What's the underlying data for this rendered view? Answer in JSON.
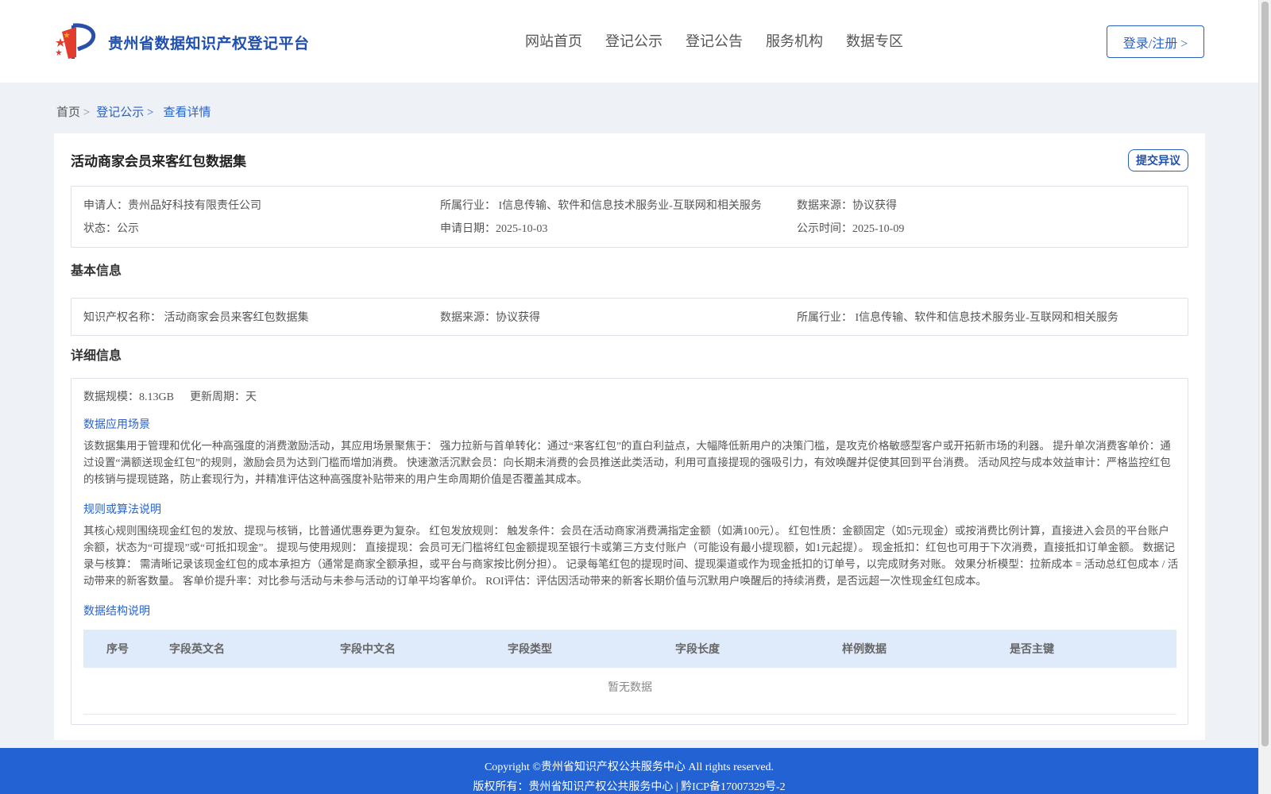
{
  "header": {
    "site_title": "贵州省数据知识产权登记平台",
    "nav": [
      "网站首页",
      "登记公示",
      "登记公告",
      "服务机构",
      "数据专区"
    ],
    "login_label": "登录/注册 >"
  },
  "breadcrumb": {
    "home": "首页",
    "sep": ">",
    "level1": "登记公示",
    "current": "查看详情"
  },
  "record": {
    "title": "活动商家会员来客红包数据集",
    "objection_label": "提交异议",
    "summary": {
      "applicant": "申请人：贵州品好科技有限责任公司",
      "industry": "所属行业： I信息传输、软件和信息技术服务业-互联网和相关服务",
      "source": "数据来源：协议获得",
      "status": "状态：公示",
      "apply_date": "申请日期：2025-10-03",
      "publish_date": "公示时间：2025-10-09"
    },
    "basic_title": "基本信息",
    "basic": {
      "ip_name": "知识产权名称： 活动商家会员来客红包数据集",
      "source": "数据来源：协议获得",
      "industry": "所属行业： I信息传输、软件和信息技术服务业-互联网和相关服务"
    },
    "detail_title": "详细信息",
    "detail": {
      "scale": "数据规模：8.13GB",
      "cycle": "更新周期：天",
      "scene_title": "数据应用场景",
      "scene_text": "该数据集用于管理和优化一种高强度的消费激励活动，其应用场景聚焦于： 强力拉新与首单转化：通过“来客红包”的直白利益点，大幅降低新用户的决策门槛，是攻克价格敏感型客户或开拓新市场的利器。 提升单次消费客单价：通过设置“满额送现金红包”的规则，激励会员为达到门槛而增加消费。 快速激活沉默会员：向长期未消费的会员推送此类活动，利用可直接提现的强吸引力，有效唤醒并促使其回到平台消费。 活动风控与成本效益审计：严格监控红包的核销与提现链路，防止套现行为，并精准评估这种高强度补贴带来的用户生命周期价值是否覆盖其成本。",
      "rule_title": "规则或算法说明",
      "rule_text": "其核心规则围绕现金红包的发放、提现与核销，比普通优惠券更为复杂。 红包发放规则： 触发条件：会员在活动商家消费满指定金额（如满100元）。 红包性质：金额固定（如5元现金）或按消费比例计算，直接进入会员的平台账户余额，状态为“可提现”或“可抵扣现金”。 提现与使用规则： 直接提现：会员可无门槛将红包金额提现至银行卡或第三方支付账户（可能设有最小提现额，如1元起提）。 现金抵扣：红包也可用于下次消费，直接抵扣订单金额。 数据记录与核算： 需清晰记录该现金红包的成本承担方（通常是商家全额承担，或平台与商家按比例分担）。 记录每笔红包的提现时间、提现渠道或作为现金抵扣的订单号，以完成财务对账。 效果分析模型：拉新成本 = 活动总红包成本 / 活动带来的新客数量。 客单价提升率：对比参与活动与未参与活动的订单平均客单价。 ROI评估：评估因活动带来的新客长期价值与沉默用户唤醒后的持续消费，是否远超一次性现金红包成本。",
      "struct_title": "数据结构说明",
      "table_headers": [
        "序号",
        "字段英文名",
        "字段中文名",
        "字段类型",
        "字段长度",
        "样例数据",
        "是否主键"
      ],
      "empty_text": "暂无数据"
    }
  },
  "footer": {
    "copyright": "Copyright ©贵州省知识产权公共服务中心 All rights reserved.",
    "owner": "版权所有：贵州省知识产权公共服务中心 | 黔ICP备17007329号-2"
  },
  "colors": {
    "brand_blue": "#2262d2",
    "link_blue": "#2a62c9",
    "table_head_bg": "#dfeafa",
    "page_bg": "#eef1f5"
  }
}
